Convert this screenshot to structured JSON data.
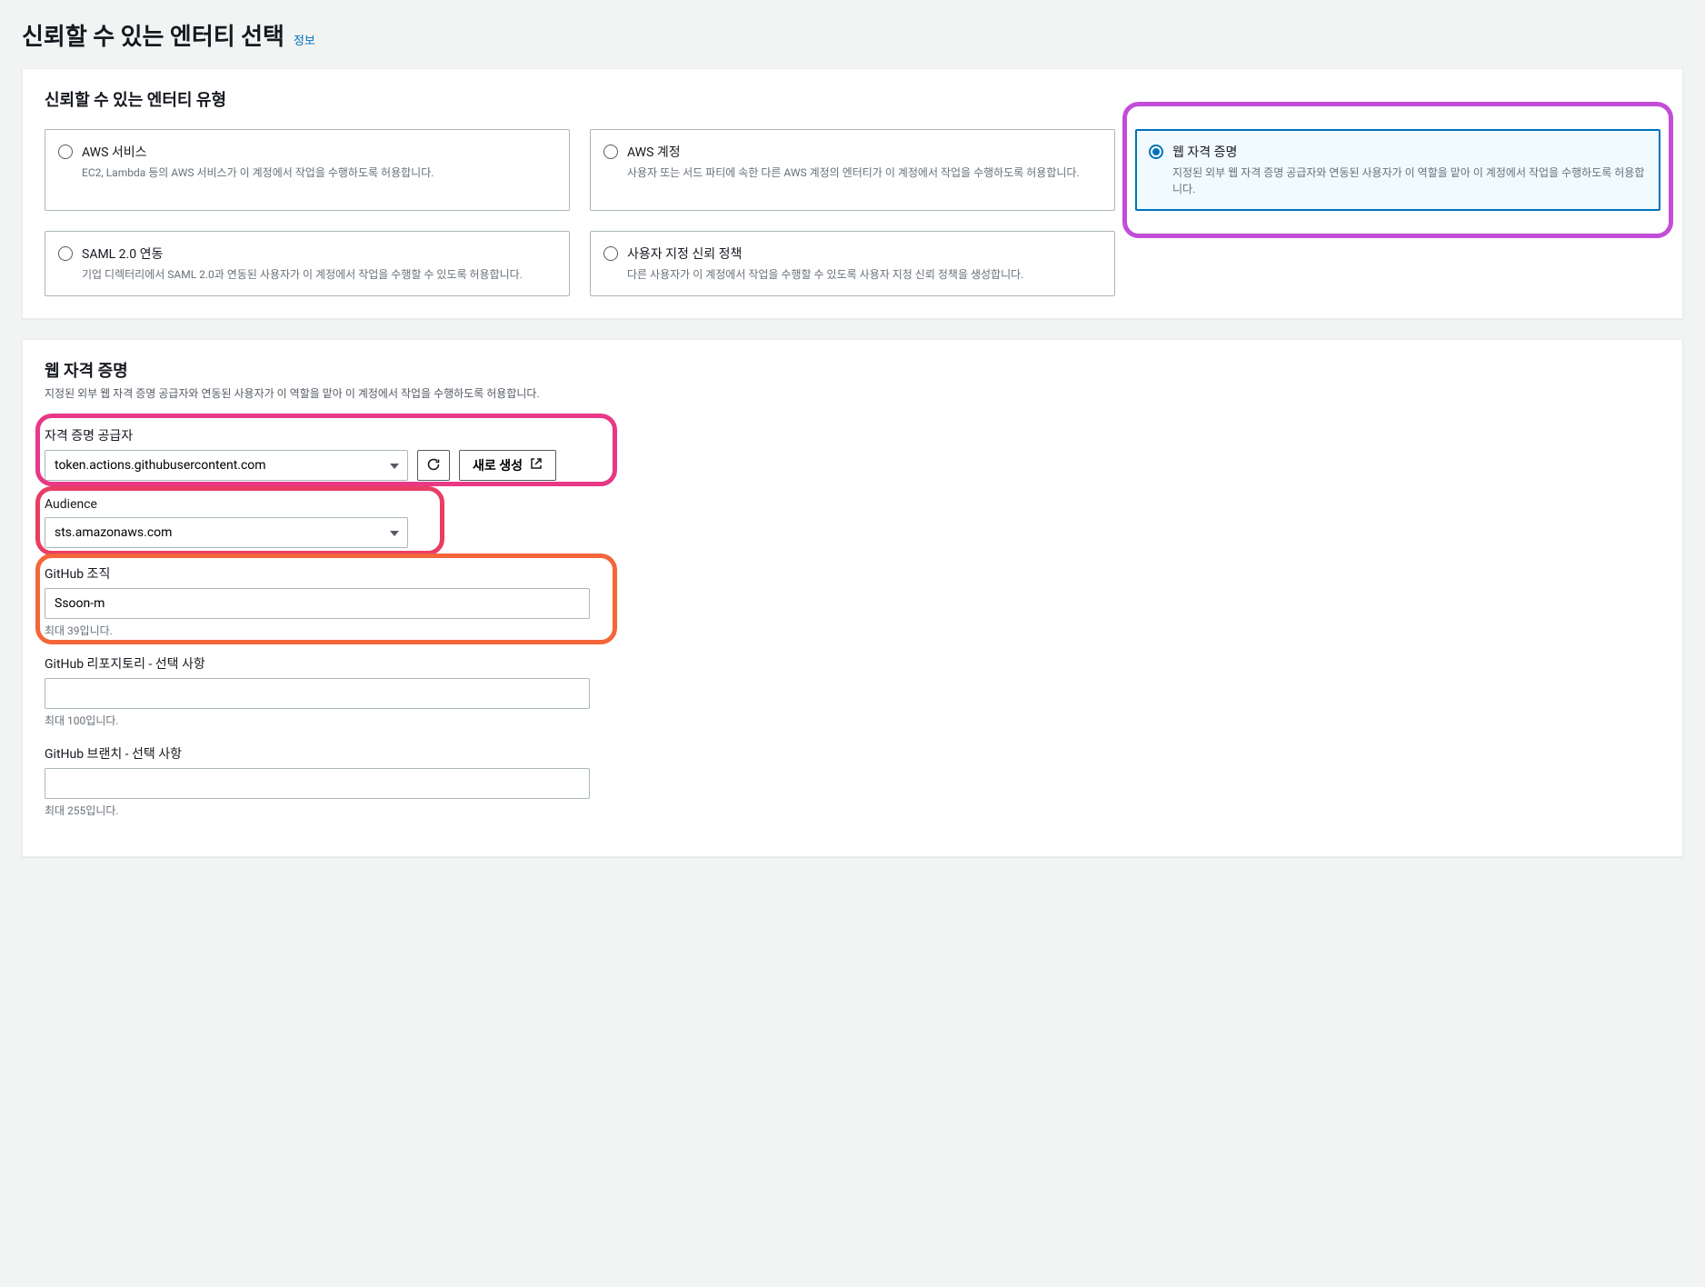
{
  "page": {
    "title": "신뢰할 수 있는 엔터티 선택",
    "info_link": "정보"
  },
  "entity_type_panel": {
    "title": "신뢰할 수 있는 엔터티 유형",
    "options": [
      {
        "title": "AWS 서비스",
        "desc": "EC2, Lambda 등의 AWS 서비스가 이 계정에서 작업을 수행하도록 허용합니다.",
        "selected": false
      },
      {
        "title": "AWS 계정",
        "desc": "사용자 또는 서드 파티에 속한 다른 AWS 계정의 엔터티가 이 계정에서 작업을 수행하도록 허용합니다.",
        "selected": false
      },
      {
        "title": "웹 자격 증명",
        "desc": "지정된 외부 웹 자격 증명 공급자와 연동된 사용자가 이 역할을 맡아 이 계정에서 작업을 수행하도록 허용합니다.",
        "selected": true
      },
      {
        "title": "SAML 2.0 연동",
        "desc": "기업 디렉터리에서 SAML 2.0과 연동된 사용자가 이 계정에서 작업을 수행할 수 있도록 허용합니다.",
        "selected": false
      },
      {
        "title": "사용자 지정 신뢰 정책",
        "desc": "다른 사용자가 이 계정에서 작업을 수행할 수 있도록 사용자 지정 신뢰 정책을 생성합니다.",
        "selected": false
      }
    ]
  },
  "web_identity_panel": {
    "title": "웹 자격 증명",
    "subtitle": "지정된 외부 웹 자격 증명 공급자와 연동된 사용자가 이 역할을 맡아 이 계정에서 작업을 수행하도록 허용합니다.",
    "provider": {
      "label": "자격 증명 공급자",
      "value": "token.actions.githubusercontent.com",
      "create_new_label": "새로 생성"
    },
    "audience": {
      "label": "Audience",
      "value": "sts.amazonaws.com"
    },
    "github_org": {
      "label": "GitHub 조직",
      "value": "Ssoon-m",
      "helper": "최대 39입니다."
    },
    "github_repo": {
      "label": "GitHub 리포지토리 - 선택 사항",
      "value": "",
      "helper": "최대 100입니다."
    },
    "github_branch": {
      "label": "GitHub 브랜치 - 선택 사항",
      "value": "",
      "helper": "최대 255입니다."
    }
  }
}
